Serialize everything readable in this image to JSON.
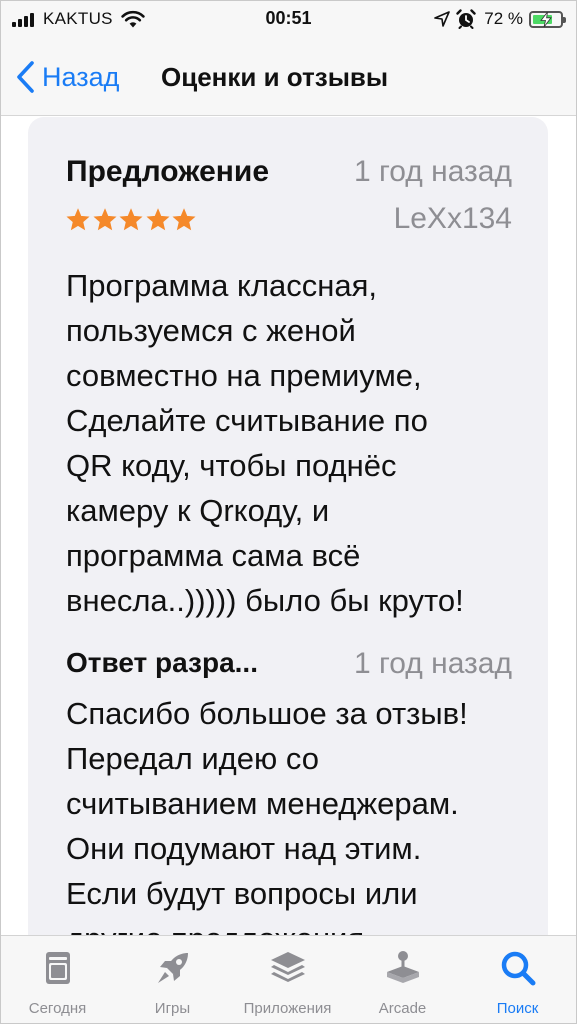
{
  "status_bar": {
    "carrier": "KAKTUS",
    "time": "00:51",
    "battery_percent": "72 %",
    "battery_level": 0.72,
    "icons": [
      "signal-icon",
      "wifi-icon",
      "location-icon",
      "alarm-icon",
      "battery-icon",
      "charging-icon"
    ]
  },
  "nav": {
    "back_label": "Назад",
    "title": "Оценки и отзывы"
  },
  "review": {
    "title": "Предложение",
    "date": "1 год назад",
    "rating": 5,
    "rating_max": 5,
    "author": "LeXx134",
    "body_lines": [
      "Программа классная,",
      "пользуемся с женой",
      "совместно на премиуме,",
      "Сделайте считывание по",
      "QR коду, чтобы поднёс",
      "камеру к Qrкоду, и",
      "программа сама всё",
      "внесла..))))) было бы круто!"
    ]
  },
  "developer_reply": {
    "title": "Ответ разра...",
    "date": "1 год назад",
    "body_lines": [
      "Спасибо большое за отзыв!",
      "Передал идею со",
      "считыванием менеджерам.",
      "Они подумают над этим.",
      "Если будут вопросы или",
      "другие предложения"
    ]
  },
  "tabs": [
    {
      "label": "Сегодня",
      "icon": "today-icon",
      "active": false
    },
    {
      "label": "Игры",
      "icon": "rocket-icon",
      "active": false
    },
    {
      "label": "Приложения",
      "icon": "apps-stack-icon",
      "active": false
    },
    {
      "label": "Arcade",
      "icon": "arcade-joystick-icon",
      "active": false
    },
    {
      "label": "Поиск",
      "icon": "search-icon",
      "active": true
    }
  ],
  "colors": {
    "accent": "#1a7cf5",
    "star": "#f5892a",
    "secondary_text": "#8e8e93",
    "card_background": "#f1f1f5",
    "battery_fill": "#4cd964"
  }
}
